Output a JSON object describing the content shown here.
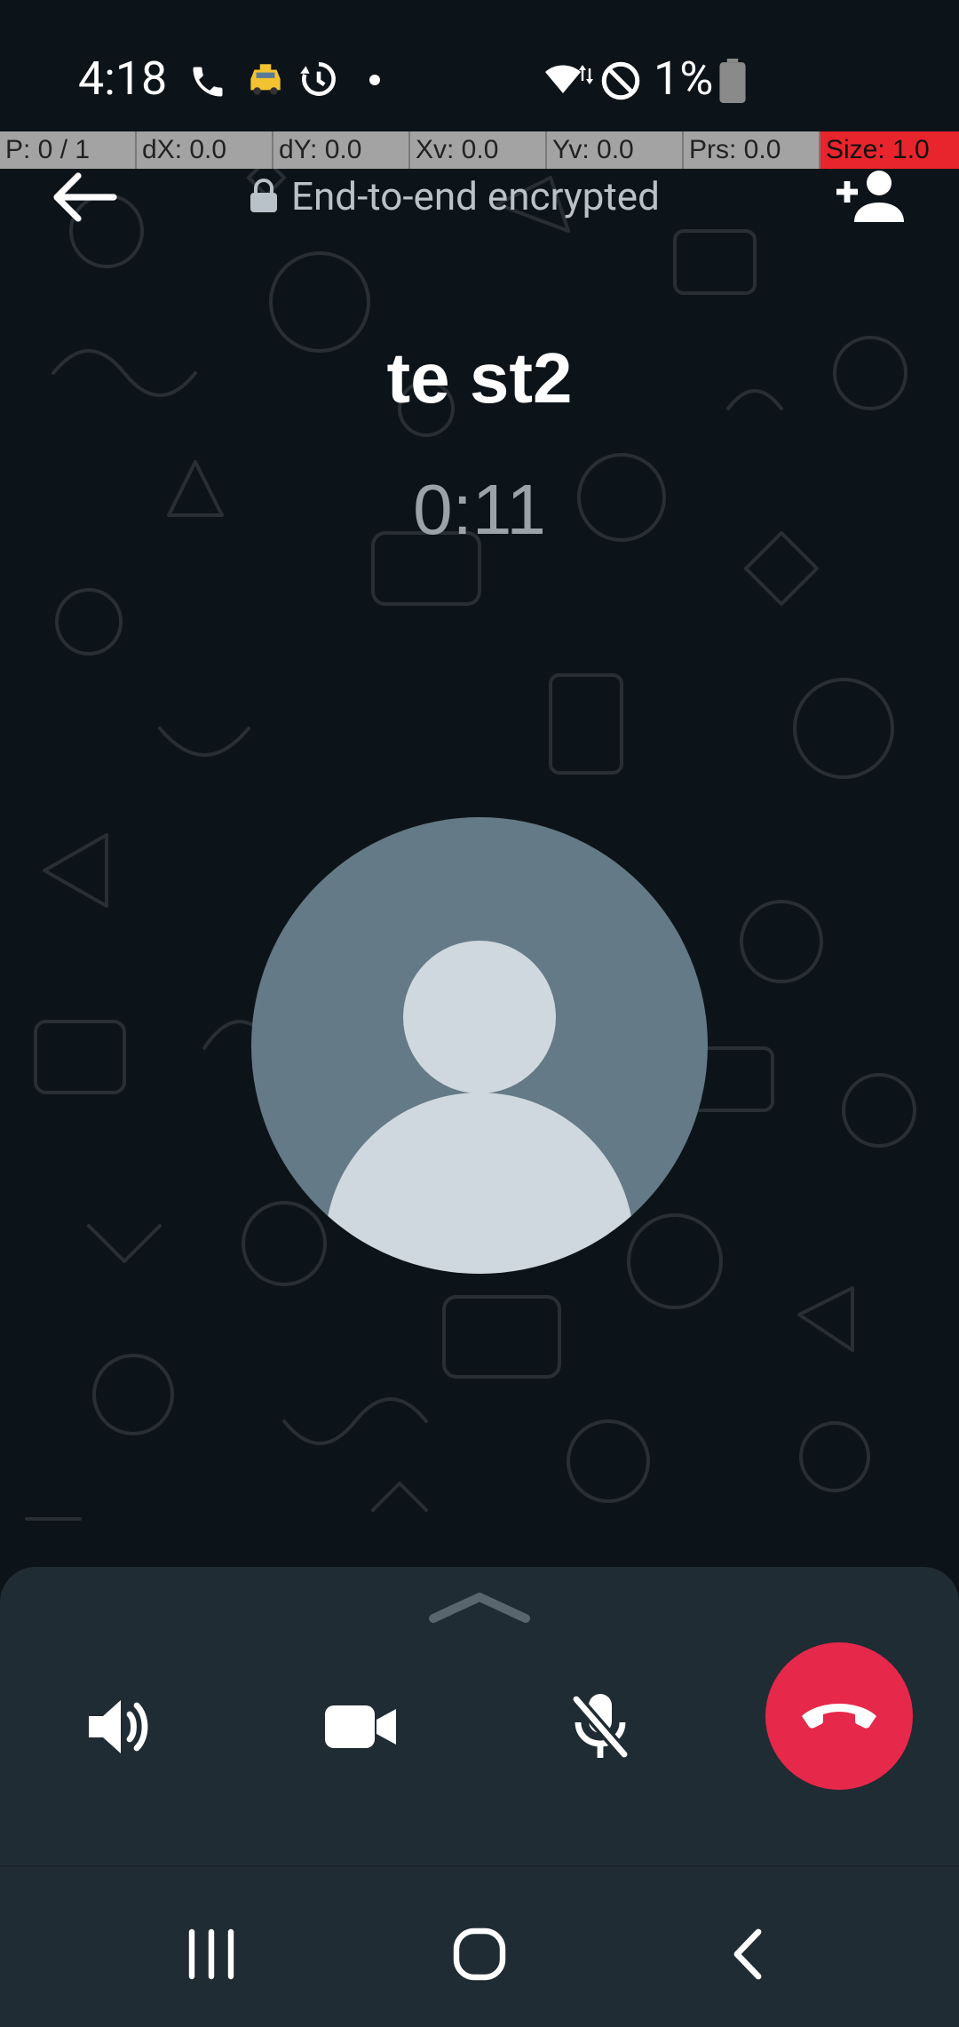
{
  "status_bar": {
    "time": "4:18",
    "battery_percent": "1%",
    "icons": [
      "phone-icon",
      "taxi-icon",
      "timer-icon",
      "dot-icon",
      "wifi-icon",
      "do-not-disturb-icon",
      "battery-icon"
    ]
  },
  "debug_overlay": {
    "pointer": "P: 0 / 1",
    "dx": "dX: 0.0",
    "dy": "dY: 0.0",
    "xv": "Xv: 0.0",
    "yv": "Yv: 0.0",
    "pressure": "Prs: 0.0",
    "size": "Size: 1.0"
  },
  "top_bar": {
    "encryption_label": "End-to-end encrypted",
    "icons": [
      "back-arrow-icon",
      "lock-icon",
      "add-person-icon"
    ]
  },
  "call": {
    "contact_name": "te st2",
    "duration": "0:11"
  },
  "controls": {
    "icons": [
      "chevron-up-icon",
      "speaker-icon",
      "video-camera-icon",
      "mic-off-icon",
      "end-call-icon"
    ],
    "end_call_color": "#e6284a"
  },
  "nav_bar": {
    "icons": [
      "recent-apps-icon",
      "home-icon",
      "back-icon"
    ]
  },
  "colors": {
    "background": "#0d1419",
    "panel": "#202c33",
    "avatar": "#647a86"
  }
}
